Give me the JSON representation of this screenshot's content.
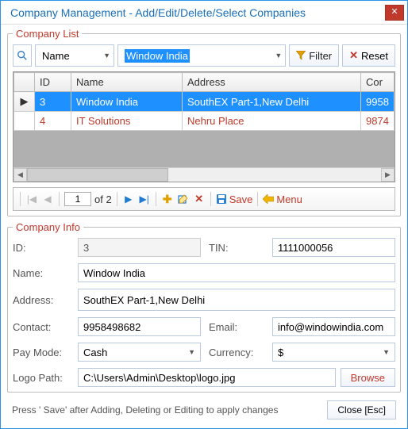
{
  "window": {
    "title": "Company Management - Add/Edit/Delete/Select Companies"
  },
  "list": {
    "legend": "Company List",
    "filter": {
      "column": "Name",
      "value": "Window India",
      "filter_label": "Filter",
      "reset_label": "Reset"
    },
    "columns": {
      "id": "ID",
      "name": "Name",
      "address": "Address",
      "contact": "Cor"
    },
    "rows": [
      {
        "selected": true,
        "id": "3",
        "name": "Window India",
        "address": "SouthEX Part-1,New Delhi",
        "contact": "9958"
      },
      {
        "selected": false,
        "id": "4",
        "name": "IT Solutions",
        "address": "Nehru Place",
        "contact": "9874"
      }
    ],
    "nav": {
      "page": "1",
      "of_label": "of 2",
      "save_label": "Save",
      "menu_label": "Menu"
    }
  },
  "info": {
    "legend": "Company Info",
    "labels": {
      "id": "ID:",
      "tin": "TIN:",
      "name": "Name:",
      "address": "Address:",
      "contact": "Contact:",
      "email": "Email:",
      "paymode": "Pay Mode:",
      "currency": "Currency:",
      "logo": "Logo Path:",
      "browse": "Browse"
    },
    "values": {
      "id": "3",
      "tin": "1111000056",
      "name": "Window India",
      "address": "SouthEX Part-1,New Delhi",
      "contact": "9958498682",
      "email": "info@windowindia.com",
      "paymode": "Cash",
      "currency": "$",
      "logo": "C:\\Users\\Admin\\Desktop\\logo.jpg"
    }
  },
  "footer": {
    "hint": "Press '       Save' after Adding, Deleting or Editing to apply changes",
    "close_label": "Close [Esc]"
  }
}
